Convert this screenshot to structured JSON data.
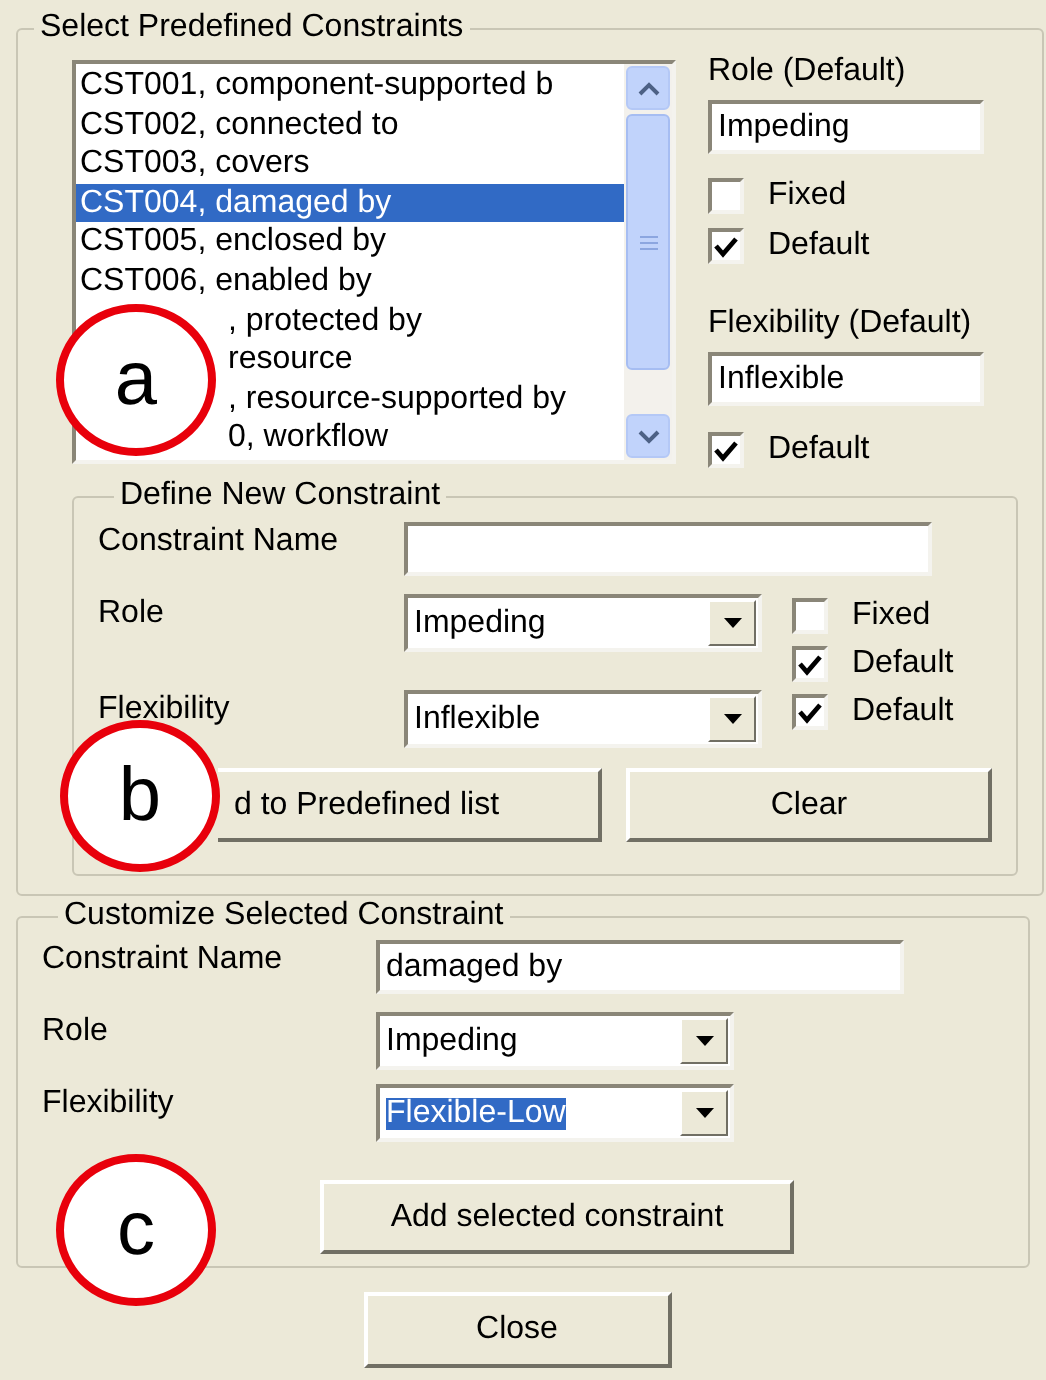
{
  "predefined": {
    "title": "Select Predefined Constraints",
    "items": [
      {
        "label": "CST001, component-supported b",
        "kind": "full",
        "selected": false
      },
      {
        "label": "CST002, connected to",
        "kind": "full",
        "selected": false
      },
      {
        "label": "CST003, covers",
        "kind": "full",
        "selected": false
      },
      {
        "label": "CST004, damaged by",
        "kind": "full",
        "selected": true
      },
      {
        "label": "CST005, enclosed by",
        "kind": "full",
        "selected": false
      },
      {
        "label": "CST006, enabled by",
        "kind": "full",
        "selected": false
      },
      {
        "label": ", protected by",
        "kind": "partly_hidden",
        "selected": false
      },
      {
        "label": "resource",
        "kind": "partly_hidden",
        "selected": false
      },
      {
        "label": ", resource-supported by",
        "kind": "partly_hidden",
        "selected": false
      },
      {
        "label": "0, workflow",
        "kind": "partly_hidden",
        "selected": false
      }
    ],
    "role_label": "Role (Default)",
    "role_value": "Impeding",
    "checks": [
      {
        "label": "Fixed",
        "checked": false
      },
      {
        "label": "Default",
        "checked": true
      }
    ],
    "flex_label": "Flexibility (Default)",
    "flex_value": "Inflexible",
    "flex_check": {
      "label": "Default",
      "checked": true
    }
  },
  "define": {
    "title": "Define New Constraint",
    "name_label": "Constraint Name",
    "role_label": "Role",
    "role_value": "Impeding",
    "flex_label": "Flexibility",
    "flex_value": "Inflexible",
    "checks": [
      {
        "label": "Fixed",
        "checked": false
      },
      {
        "label": "Default",
        "checked": true
      },
      {
        "label": "Default",
        "checked": true
      }
    ],
    "buttons": [
      "d to Predefined list",
      "Clear"
    ]
  },
  "customize": {
    "title": "Customize Selected Constraint",
    "name_label": "Constraint Name",
    "name_value": "damaged by",
    "role_label": "Role",
    "role_value": "Impeding",
    "flex_label": "Flexibility",
    "flex_value": "Flexible-Low",
    "flex_highlighted": true,
    "button": "Add selected constraint"
  },
  "close_button": "Close",
  "callouts": [
    "a",
    "b",
    "c"
  ]
}
